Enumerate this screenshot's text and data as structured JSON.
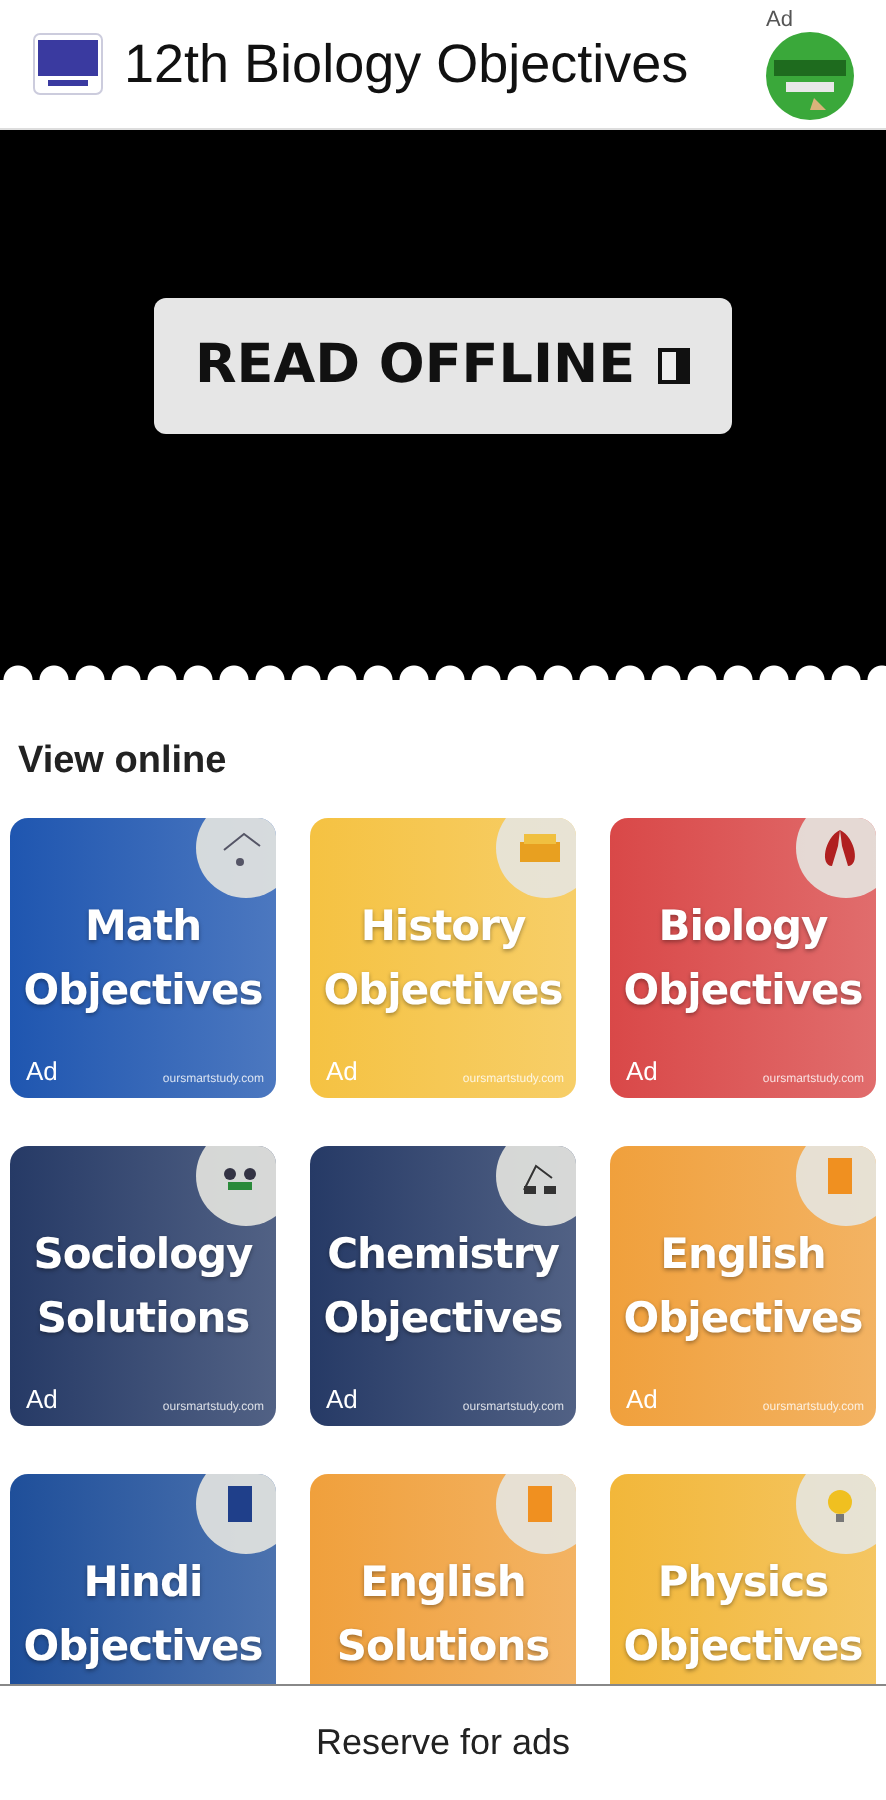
{
  "app_bar": {
    "title": "12th Biology Objectives",
    "ad_label": "Ad"
  },
  "banner": {
    "button": "READ OFFLINE"
  },
  "section_title": "View online",
  "cards": [
    {
      "line1": "Math",
      "line2": "Objectives",
      "ad": "Ad",
      "site": "oursmartstudy.com",
      "color": "#1f56b0"
    },
    {
      "line1": "History",
      "line2": "Objectives",
      "ad": "Ad",
      "site": "oursmartstudy.com",
      "color": "#f5c242"
    },
    {
      "line1": "Biology",
      "line2": "Objectives",
      "ad": "Ad",
      "site": "oursmartstudy.com",
      "color": "#d94848"
    },
    {
      "line1": "Sociology",
      "line2": "Solutions",
      "ad": "Ad",
      "site": "oursmartstudy.com",
      "color": "#263a66"
    },
    {
      "line1": "Chemistry",
      "line2": "Objectives",
      "ad": "Ad",
      "site": "oursmartstudy.com",
      "color": "#263a66"
    },
    {
      "line1": "English",
      "line2": "Objectives",
      "ad": "Ad",
      "site": "oursmartstudy.com",
      "color": "#f0a03c"
    },
    {
      "line1": "Hindi",
      "line2": "Objectives",
      "color": "#1f4f9a"
    },
    {
      "line1": "English",
      "line2": "Solutions",
      "color": "#f0a03c"
    },
    {
      "line1": "Physics",
      "line2": "Objectives",
      "color": "#f2b73a"
    }
  ],
  "bottom_bar": {
    "text": "Reserve for ads"
  }
}
